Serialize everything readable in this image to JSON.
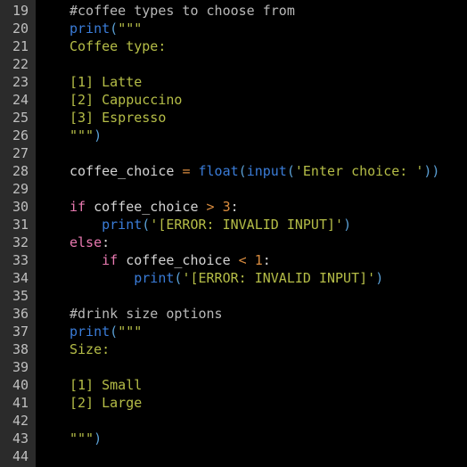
{
  "editor": {
    "language": "python",
    "background": "#000000",
    "gutter_background": "#2b2b2b",
    "line_number_color": "#bfbfbf",
    "first_visible_line": 19,
    "last_visible_line": 44,
    "colors": {
      "comment": "#b8b8b8",
      "keyword": "#e879b0",
      "builtin": "#3a7cd8",
      "string": "#b5bd47",
      "number": "#d98c3f",
      "operator": "#d98c3f",
      "punctuation": "#5a9fd4",
      "identifier": "#d4d4d4"
    }
  },
  "line_numbers": [
    19,
    20,
    21,
    22,
    23,
    24,
    25,
    26,
    27,
    28,
    29,
    30,
    31,
    32,
    33,
    34,
    35,
    36,
    37,
    38,
    39,
    40,
    41,
    42,
    43,
    44
  ],
  "lines": [
    {
      "n": 19,
      "text": "#coffee types to choose from",
      "tokens": [
        {
          "t": "#coffee types to choose from",
          "c": "comment"
        }
      ]
    },
    {
      "n": 20,
      "text": "print(\"\"\"",
      "tokens": [
        {
          "t": "print",
          "c": "builtin"
        },
        {
          "t": "(",
          "c": "punct"
        },
        {
          "t": "\"\"\"",
          "c": "string"
        }
      ]
    },
    {
      "n": 21,
      "text": "Coffee type:",
      "tokens": [
        {
          "t": "Coffee type:",
          "c": "string"
        }
      ]
    },
    {
      "n": 22,
      "text": "",
      "tokens": []
    },
    {
      "n": 23,
      "text": "[1] Latte",
      "tokens": [
        {
          "t": "[1] Latte",
          "c": "string"
        }
      ]
    },
    {
      "n": 24,
      "text": "[2] Cappuccino",
      "tokens": [
        {
          "t": "[2] Cappuccino",
          "c": "string"
        }
      ]
    },
    {
      "n": 25,
      "text": "[3] Espresso",
      "tokens": [
        {
          "t": "[3] Espresso",
          "c": "string"
        }
      ]
    },
    {
      "n": 26,
      "text": "\"\"\")",
      "tokens": [
        {
          "t": "\"\"\"",
          "c": "string"
        },
        {
          "t": ")",
          "c": "punct"
        }
      ]
    },
    {
      "n": 27,
      "text": "",
      "tokens": []
    },
    {
      "n": 28,
      "text": "coffee_choice = float(input('Enter choice: '))",
      "tokens": [
        {
          "t": "coffee_choice ",
          "c": "ident"
        },
        {
          "t": "=",
          "c": "operator"
        },
        {
          "t": " ",
          "c": "plain"
        },
        {
          "t": "float",
          "c": "builtin"
        },
        {
          "t": "(",
          "c": "punct"
        },
        {
          "t": "input",
          "c": "builtin"
        },
        {
          "t": "(",
          "c": "punct"
        },
        {
          "t": "'Enter choice: '",
          "c": "string"
        },
        {
          "t": "))",
          "c": "punct"
        }
      ]
    },
    {
      "n": 29,
      "text": "",
      "tokens": []
    },
    {
      "n": 30,
      "text": "if coffee_choice > 3:",
      "tokens": [
        {
          "t": "if",
          "c": "keyword"
        },
        {
          "t": " coffee_choice ",
          "c": "ident"
        },
        {
          "t": ">",
          "c": "operator"
        },
        {
          "t": " ",
          "c": "plain"
        },
        {
          "t": "3",
          "c": "number"
        },
        {
          "t": ":",
          "c": "plain"
        }
      ]
    },
    {
      "n": 31,
      "text": "    print('[ERROR: INVALID INPUT]')",
      "tokens": [
        {
          "t": "    ",
          "c": "plain"
        },
        {
          "t": "print",
          "c": "builtin"
        },
        {
          "t": "(",
          "c": "punct"
        },
        {
          "t": "'[ERROR: INVALID INPUT]'",
          "c": "string"
        },
        {
          "t": ")",
          "c": "punct"
        }
      ]
    },
    {
      "n": 32,
      "text": "else:",
      "tokens": [
        {
          "t": "else",
          "c": "keyword"
        },
        {
          "t": ":",
          "c": "plain"
        }
      ]
    },
    {
      "n": 33,
      "text": "    if coffee_choice < 1:",
      "tokens": [
        {
          "t": "    ",
          "c": "plain"
        },
        {
          "t": "if",
          "c": "keyword"
        },
        {
          "t": " coffee_choice ",
          "c": "ident"
        },
        {
          "t": "<",
          "c": "operator"
        },
        {
          "t": " ",
          "c": "plain"
        },
        {
          "t": "1",
          "c": "number"
        },
        {
          "t": ":",
          "c": "plain"
        }
      ]
    },
    {
      "n": 34,
      "text": "        print('[ERROR: INVALID INPUT]')",
      "tokens": [
        {
          "t": "        ",
          "c": "plain"
        },
        {
          "t": "print",
          "c": "builtin"
        },
        {
          "t": "(",
          "c": "punct"
        },
        {
          "t": "'[ERROR: INVALID INPUT]'",
          "c": "string"
        },
        {
          "t": ")",
          "c": "punct"
        }
      ]
    },
    {
      "n": 35,
      "text": "",
      "tokens": []
    },
    {
      "n": 36,
      "text": "#drink size options",
      "tokens": [
        {
          "t": "#drink size options",
          "c": "comment"
        }
      ]
    },
    {
      "n": 37,
      "text": "print(\"\"\"",
      "tokens": [
        {
          "t": "print",
          "c": "builtin"
        },
        {
          "t": "(",
          "c": "punct"
        },
        {
          "t": "\"\"\"",
          "c": "string"
        }
      ]
    },
    {
      "n": 38,
      "text": "Size:",
      "tokens": [
        {
          "t": "Size:",
          "c": "string"
        }
      ]
    },
    {
      "n": 39,
      "text": "",
      "tokens": []
    },
    {
      "n": 40,
      "text": "[1] Small",
      "tokens": [
        {
          "t": "[1] Small",
          "c": "string"
        }
      ]
    },
    {
      "n": 41,
      "text": "[2] Large",
      "tokens": [
        {
          "t": "[2] Large",
          "c": "string"
        }
      ]
    },
    {
      "n": 42,
      "text": "",
      "tokens": []
    },
    {
      "n": 43,
      "text": "\"\"\")",
      "tokens": [
        {
          "t": "\"\"\"",
          "c": "string"
        },
        {
          "t": ")",
          "c": "punct"
        }
      ]
    },
    {
      "n": 44,
      "text": "",
      "tokens": []
    }
  ]
}
